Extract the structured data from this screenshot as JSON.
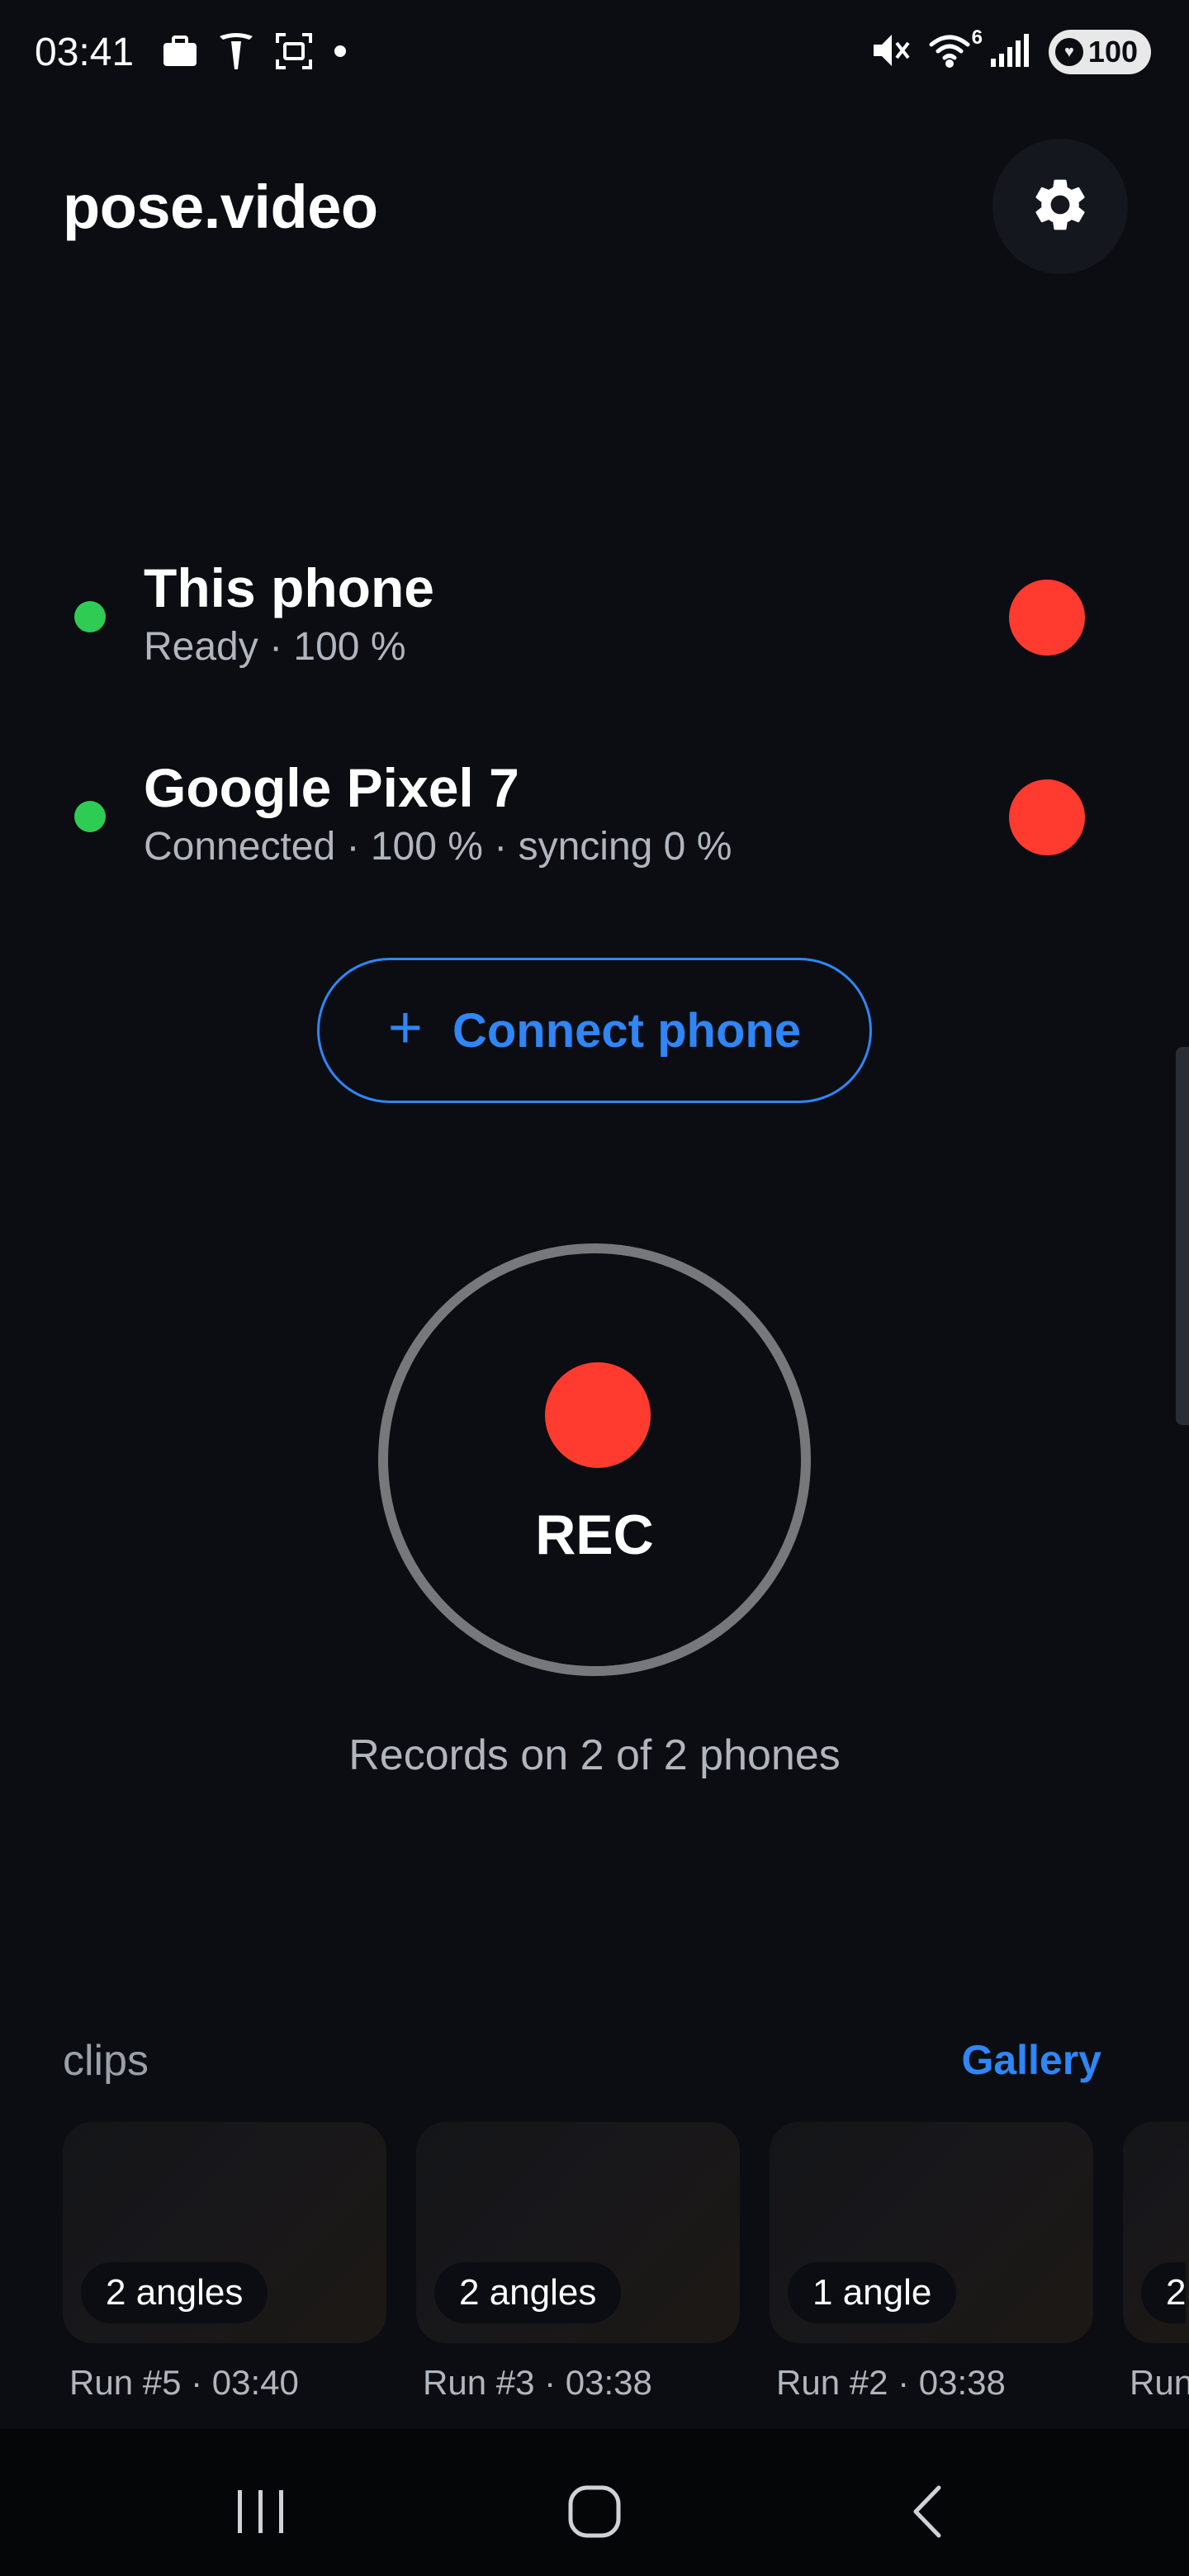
{
  "status_bar": {
    "time": "03:41",
    "left_icons": [
      "briefcase-icon",
      "tesla-icon",
      "screenshot-icon",
      "dot-icon"
    ],
    "right_icons": [
      "mute-icon",
      "wifi-icon",
      "signal-icon"
    ],
    "wifi_superscript": "6",
    "battery": "100"
  },
  "header": {
    "title": "pose.video",
    "settings_icon": "gear-icon"
  },
  "devices": [
    {
      "name": "This phone",
      "status": "Ready · 100 %",
      "status_color": "#2ecc52"
    },
    {
      "name": "Google Pixel 7",
      "status": "Connected · 100 % · syncing 0 %",
      "status_color": "#2ecc52"
    }
  ],
  "connect_button": {
    "icon": "plus-icon",
    "label": "Connect phone"
  },
  "record": {
    "label": "REC",
    "caption": "Records on 2 of 2 phones"
  },
  "clips": {
    "heading": "clips",
    "gallery_link": "Gallery",
    "items": [
      {
        "badge": "2 angles",
        "caption": "Run #5 · 03:40"
      },
      {
        "badge": "2 angles",
        "caption": "Run #3 · 03:38"
      },
      {
        "badge": "1 angle",
        "caption": "Run #2 · 03:38"
      },
      {
        "badge": "2",
        "caption": "Run"
      }
    ]
  },
  "nav_bar": {
    "items": [
      "recents-icon",
      "home-icon",
      "back-icon"
    ]
  },
  "colors": {
    "background": "#0b0d12",
    "accent": "#2f86f6",
    "record_red": "#ff3b30",
    "status_green": "#2ecc52"
  }
}
